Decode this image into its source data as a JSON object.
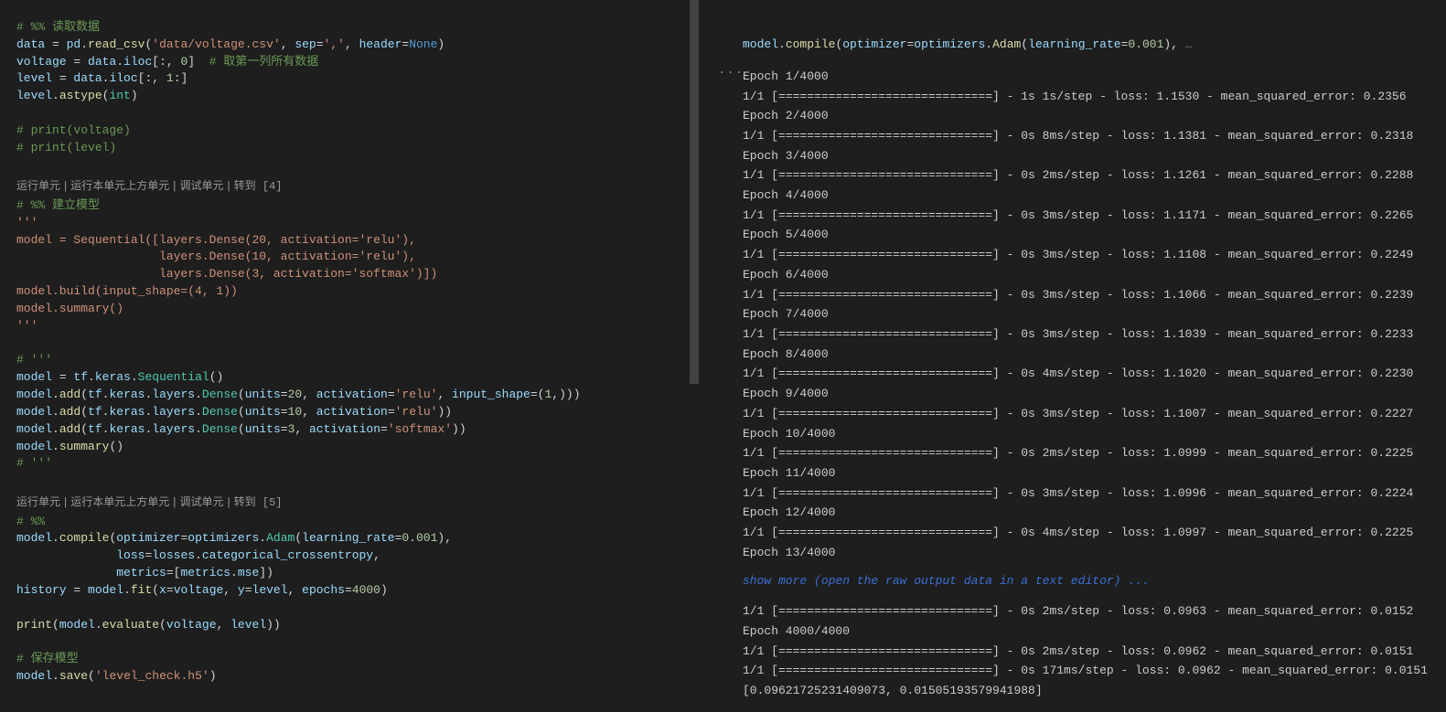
{
  "codelens": {
    "run_cell": "运行单元",
    "run_above": "运行本单元上方单元",
    "debug_cell": "调试单元",
    "goto_prefix": "转到",
    "goto_a": "[4]",
    "goto_b": "[5]",
    "sep": "|"
  },
  "left_code": {
    "l01_a": "# %% 读取数据",
    "l02_a": "data",
    "l02_b": " = ",
    "l02_c": "pd",
    "l02_d": ".",
    "l02_e": "read_csv",
    "l02_f": "(",
    "l02_g": "'data/voltage.csv'",
    "l02_h": ", ",
    "l02_i": "sep",
    "l02_j": "=",
    "l02_k": "','",
    "l02_l": ", ",
    "l02_m": "header",
    "l02_n": "=",
    "l02_o": "None",
    "l02_p": ")",
    "l03_a": "voltage",
    "l03_b": " = ",
    "l03_c": "data",
    "l03_d": ".",
    "l03_e": "iloc",
    "l03_f": "[:, ",
    "l03_g": "0",
    "l03_h": "]  ",
    "l03_i": "# 取第一列所有数据",
    "l04_a": "level",
    "l04_b": " = ",
    "l04_c": "data",
    "l04_d": ".",
    "l04_e": "iloc",
    "l04_f": "[:, ",
    "l04_g": "1",
    "l04_h": ":]",
    "l05_a": "level",
    "l05_b": ".",
    "l05_c": "astype",
    "l05_d": "(",
    "l05_e": "int",
    "l05_f": ")",
    "l07_a": "# print(voltage)",
    "l08_a": "# print(level)",
    "l11_a": "# %% 建立模型",
    "l12_a": "'''",
    "l13_a": "model = Sequential([layers.Dense(20, activation='relu'),",
    "l14_a": "                    layers.Dense(10, activation='relu'),",
    "l15_a": "                    layers.Dense(3, activation='softmax')])",
    "l16_a": "model.build(input_shape=(4, 1))",
    "l17_a": "model.summary()",
    "l18_a": "'''",
    "l20_a": "# '''",
    "l21_a": "model",
    "l21_b": " = ",
    "l21_c": "tf",
    "l21_d": ".",
    "l21_e": "keras",
    "l21_f": ".",
    "l21_g": "Sequential",
    "l21_h": "()",
    "l22_a": "model",
    "l22_b": ".",
    "l22_c": "add",
    "l22_d": "(",
    "l22_e": "tf",
    "l22_f": ".",
    "l22_g": "keras",
    "l22_h": ".",
    "l22_i": "layers",
    "l22_j": ".",
    "l22_k": "Dense",
    "l22_l": "(",
    "l22_m": "units",
    "l22_n": "=",
    "l22_o": "20",
    "l22_p": ", ",
    "l22_q": "activation",
    "l22_r": "=",
    "l22_s": "'relu'",
    "l22_t": ", ",
    "l22_u": "input_shape",
    "l22_v": "=(",
    "l22_w": "1",
    "l22_x": ",)))",
    "l23_a": "model",
    "l23_b": ".",
    "l23_c": "add",
    "l23_d": "(",
    "l23_e": "tf",
    "l23_f": ".",
    "l23_g": "keras",
    "l23_h": ".",
    "l23_i": "layers",
    "l23_j": ".",
    "l23_k": "Dense",
    "l23_l": "(",
    "l23_m": "units",
    "l23_n": "=",
    "l23_o": "10",
    "l23_p": ", ",
    "l23_q": "activation",
    "l23_r": "=",
    "l23_s": "'relu'",
    "l23_t": "))",
    "l24_a": "model",
    "l24_b": ".",
    "l24_c": "add",
    "l24_d": "(",
    "l24_e": "tf",
    "l24_f": ".",
    "l24_g": "keras",
    "l24_h": ".",
    "l24_i": "layers",
    "l24_j": ".",
    "l24_k": "Dense",
    "l24_l": "(",
    "l24_m": "units",
    "l24_n": "=",
    "l24_o": "3",
    "l24_p": ", ",
    "l24_q": "activation",
    "l24_r": "=",
    "l24_s": "'softmax'",
    "l24_t": "))",
    "l25_a": "model",
    "l25_b": ".",
    "l25_c": "summary",
    "l25_d": "()",
    "l26_a": "# '''",
    "l29_a": "# %%",
    "l30_a": "model",
    "l30_b": ".",
    "l30_c": "compile",
    "l30_d": "(",
    "l30_e": "optimizer",
    "l30_f": "=",
    "l30_g": "optimizers",
    "l30_h": ".",
    "l30_i": "Adam",
    "l30_j": "(",
    "l30_k": "learning_rate",
    "l30_l": "=",
    "l30_m": "0.001",
    "l30_n": "),",
    "l31_a": "              ",
    "l31_b": "loss",
    "l31_c": "=",
    "l31_d": "losses",
    "l31_e": ".",
    "l31_f": "categorical_crossentropy",
    "l31_g": ",",
    "l32_a": "              ",
    "l32_b": "metrics",
    "l32_c": "=[",
    "l32_d": "metrics",
    "l32_e": ".",
    "l32_f": "mse",
    "l32_g": "])",
    "l33_a": "history",
    "l33_b": " = ",
    "l33_c": "model",
    "l33_d": ".",
    "l33_e": "fit",
    "l33_f": "(",
    "l33_g": "x",
    "l33_h": "=",
    "l33_i": "voltage",
    "l33_j": ", ",
    "l33_k": "y",
    "l33_l": "=",
    "l33_m": "level",
    "l33_n": ", ",
    "l33_o": "epochs",
    "l33_p": "=",
    "l33_q": "4000",
    "l33_r": ")",
    "l35_a": "print",
    "l35_b": "(",
    "l35_c": "model",
    "l35_d": ".",
    "l35_e": "evaluate",
    "l35_f": "(",
    "l35_g": "voltage",
    "l35_h": ", ",
    "l35_i": "level",
    "l35_j": "))",
    "l37_a": "# 保存模型",
    "l38_a": "model",
    "l38_b": ".",
    "l38_c": "save",
    "l38_d": "(",
    "l38_e": "'level_check.h5'",
    "l38_f": ")"
  },
  "right": {
    "ellipsis": "···",
    "header_a": "model",
    "header_b": ".",
    "header_c": "compile",
    "header_d": "(",
    "header_e": "optimizer",
    "header_f": "=",
    "header_g": "optimizers",
    "header_h": ".",
    "header_i": "Adam",
    "header_j": "(",
    "header_k": "learning_rate",
    "header_l": "=",
    "header_m": "0.001",
    "header_n": "), ",
    "header_o": "…",
    "lines_top": [
      "Epoch 1/4000",
      "1/1 [==============================] - 1s 1s/step - loss: 1.1530 - mean_squared_error: 0.2356",
      "Epoch 2/4000",
      "1/1 [==============================] - 0s 8ms/step - loss: 1.1381 - mean_squared_error: 0.2318",
      "Epoch 3/4000",
      "1/1 [==============================] - 0s 2ms/step - loss: 1.1261 - mean_squared_error: 0.2288",
      "Epoch 4/4000",
      "1/1 [==============================] - 0s 3ms/step - loss: 1.1171 - mean_squared_error: 0.2265",
      "Epoch 5/4000",
      "1/1 [==============================] - 0s 3ms/step - loss: 1.1108 - mean_squared_error: 0.2249",
      "Epoch 6/4000",
      "1/1 [==============================] - 0s 3ms/step - loss: 1.1066 - mean_squared_error: 0.2239",
      "Epoch 7/4000",
      "1/1 [==============================] - 0s 3ms/step - loss: 1.1039 - mean_squared_error: 0.2233",
      "Epoch 8/4000",
      "1/1 [==============================] - 0s 4ms/step - loss: 1.1020 - mean_squared_error: 0.2230",
      "Epoch 9/4000",
      "1/1 [==============================] - 0s 3ms/step - loss: 1.1007 - mean_squared_error: 0.2227",
      "Epoch 10/4000",
      "1/1 [==============================] - 0s 2ms/step - loss: 1.0999 - mean_squared_error: 0.2225",
      "Epoch 11/4000",
      "1/1 [==============================] - 0s 3ms/step - loss: 1.0996 - mean_squared_error: 0.2224",
      "Epoch 12/4000",
      "1/1 [==============================] - 0s 4ms/step - loss: 1.0997 - mean_squared_error: 0.2225",
      "Epoch 13/4000"
    ],
    "show_more": "show more (open the raw output data in a text editor) ...",
    "lines_bottom": [
      "1/1 [==============================] - 0s 2ms/step - loss: 0.0963 - mean_squared_error: 0.0152",
      "Epoch 4000/4000",
      "1/1 [==============================] - 0s 2ms/step - loss: 0.0962 - mean_squared_error: 0.0151",
      "1/1 [==============================] - 0s 171ms/step - loss: 0.0962 - mean_squared_error: 0.0151",
      "[0.0962172523140907​3, 0.01505193579941988]"
    ]
  }
}
